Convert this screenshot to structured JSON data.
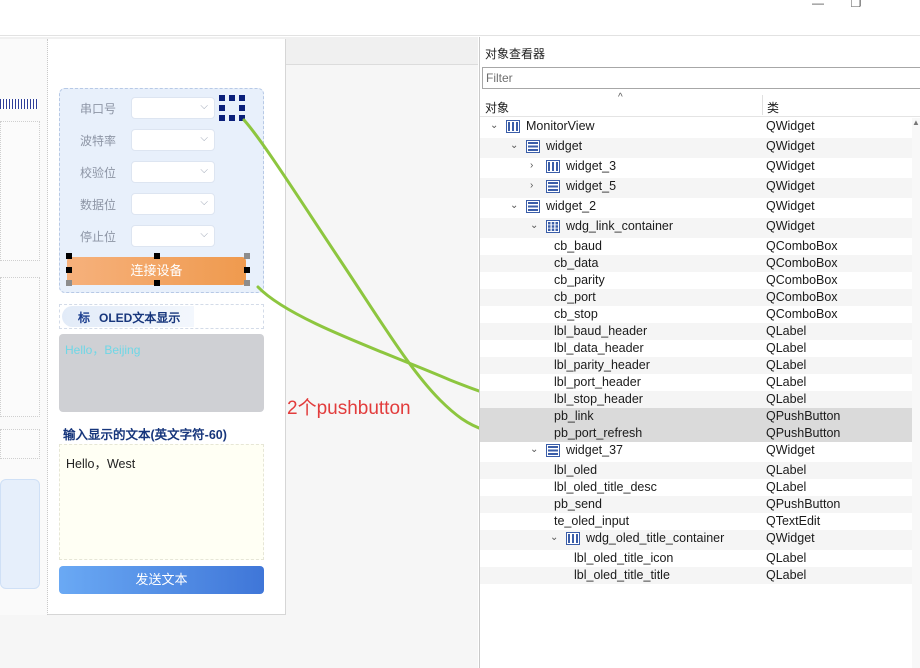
{
  "window": {
    "minimize": "—",
    "maximize": "❐"
  },
  "canvas": {
    "link_container": {
      "fields": [
        {
          "label": "串口号"
        },
        {
          "label": "波特率"
        },
        {
          "label": "校验位"
        },
        {
          "label": "数据位"
        },
        {
          "label": "停止位"
        }
      ],
      "connect_button": "连接设备"
    },
    "oled": {
      "title_icon": "标",
      "title": "OLED文本显示",
      "display_text": "Hello，Beijing",
      "input_header": "输入显示的文本(英文字符-60)",
      "input_text": "Hello，West",
      "send_button": "发送文本"
    },
    "annotation": "2个pushbutton",
    "colors": {
      "annotation": "#e23c3c",
      "connector": "#8dc63f",
      "connect_button": "#ef9a4e",
      "send_button": "#3f76d8"
    }
  },
  "inspector": {
    "title": "对象查看器",
    "filter_placeholder": "Filter",
    "col_object": "对象",
    "col_class": "类",
    "rows": [
      {
        "name": "MonitorView",
        "cls": "QWidget",
        "depth": 0,
        "twisty": "open",
        "icon": "hbox-icon"
      },
      {
        "name": "widget",
        "cls": "QWidget",
        "depth": 1,
        "twisty": "open",
        "icon": "vbox-icon"
      },
      {
        "name": "widget_3",
        "cls": "QWidget",
        "depth": 2,
        "twisty": "closed",
        "icon": "hbox-icon"
      },
      {
        "name": "widget_5",
        "cls": "QWidget",
        "depth": 2,
        "twisty": "closed",
        "icon": "vbox-icon"
      },
      {
        "name": "widget_2",
        "cls": "QWidget",
        "depth": 1,
        "twisty": "open",
        "icon": "vbox-icon"
      },
      {
        "name": "wdg_link_container",
        "cls": "QWidget",
        "depth": 2,
        "twisty": "open",
        "icon": "grid-icon"
      },
      {
        "name": "cb_baud",
        "cls": "QComboBox",
        "depth": 3,
        "twisty": "none",
        "icon": ""
      },
      {
        "name": "cb_data",
        "cls": "QComboBox",
        "depth": 3,
        "twisty": "none",
        "icon": ""
      },
      {
        "name": "cb_parity",
        "cls": "QComboBox",
        "depth": 3,
        "twisty": "none",
        "icon": ""
      },
      {
        "name": "cb_port",
        "cls": "QComboBox",
        "depth": 3,
        "twisty": "none",
        "icon": ""
      },
      {
        "name": "cb_stop",
        "cls": "QComboBox",
        "depth": 3,
        "twisty": "none",
        "icon": ""
      },
      {
        "name": "lbl_baud_header",
        "cls": "QLabel",
        "depth": 3,
        "twisty": "none",
        "icon": ""
      },
      {
        "name": "lbl_data_header",
        "cls": "QLabel",
        "depth": 3,
        "twisty": "none",
        "icon": ""
      },
      {
        "name": "lbl_parity_header",
        "cls": "QLabel",
        "depth": 3,
        "twisty": "none",
        "icon": ""
      },
      {
        "name": "lbl_port_header",
        "cls": "QLabel",
        "depth": 3,
        "twisty": "none",
        "icon": ""
      },
      {
        "name": "lbl_stop_header",
        "cls": "QLabel",
        "depth": 3,
        "twisty": "none",
        "icon": ""
      },
      {
        "name": "pb_link",
        "cls": "QPushButton",
        "depth": 3,
        "twisty": "none",
        "icon": "",
        "selected": true
      },
      {
        "name": "pb_port_refresh",
        "cls": "QPushButton",
        "depth": 3,
        "twisty": "none",
        "icon": "",
        "selected": true
      },
      {
        "name": "widget_37",
        "cls": "QWidget",
        "depth": 2,
        "twisty": "open",
        "icon": "vbox-icon"
      },
      {
        "name": "lbl_oled",
        "cls": "QLabel",
        "depth": 3,
        "twisty": "none",
        "icon": ""
      },
      {
        "name": "lbl_oled_title_desc",
        "cls": "QLabel",
        "depth": 3,
        "twisty": "none",
        "icon": ""
      },
      {
        "name": "pb_send",
        "cls": "QPushButton",
        "depth": 3,
        "twisty": "none",
        "icon": ""
      },
      {
        "name": "te_oled_input",
        "cls": "QTextEdit",
        "depth": 3,
        "twisty": "none",
        "icon": ""
      },
      {
        "name": "wdg_oled_title_container",
        "cls": "QWidget",
        "depth": 3,
        "twisty": "open",
        "icon": "hbox-icon"
      },
      {
        "name": "lbl_oled_title_icon",
        "cls": "QLabel",
        "depth": 4,
        "twisty": "none",
        "icon": ""
      },
      {
        "name": "lbl_oled_title_title",
        "cls": "QLabel",
        "depth": 4,
        "twisty": "none",
        "icon": ""
      }
    ]
  }
}
